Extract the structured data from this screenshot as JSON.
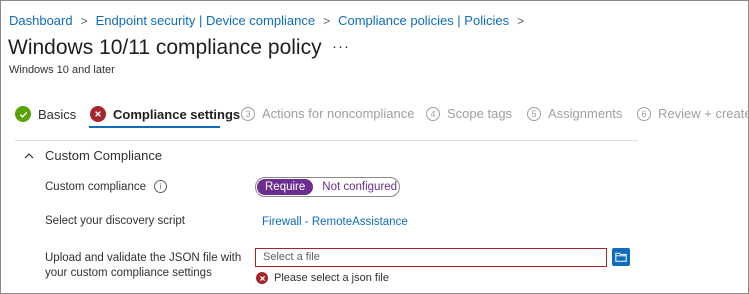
{
  "breadcrumb": {
    "items": [
      "Dashboard",
      "Endpoint security | Device compliance",
      "Compliance policies | Policies"
    ],
    "separator": ">"
  },
  "page": {
    "title": "Windows 10/11 compliance policy",
    "more": "···",
    "subtitle": "Windows 10 and later"
  },
  "wizard": {
    "steps": [
      {
        "number": "",
        "label": "Basics",
        "state": "completed",
        "icon": "check-icon"
      },
      {
        "number": "",
        "label": "Compliance settings",
        "state": "current-error",
        "icon": "error-icon"
      },
      {
        "number": "3",
        "label": "Actions for noncompliance",
        "state": "pending"
      },
      {
        "number": "4",
        "label": "Scope tags",
        "state": "pending"
      },
      {
        "number": "5",
        "label": "Assignments",
        "state": "pending"
      },
      {
        "number": "6",
        "label": "Review + create",
        "state": "pending"
      }
    ]
  },
  "section": {
    "title": "Custom Compliance",
    "expanded": true,
    "custom_compliance": {
      "label": "Custom compliance",
      "info_icon": "i",
      "options": [
        "Require",
        "Not configured"
      ],
      "selected": "Require"
    },
    "discovery_script": {
      "label": "Select your discovery script",
      "value": "Firewall - RemoteAssistance"
    },
    "json_upload": {
      "label_line1": "Upload and validate the JSON file with",
      "label_line2": "your custom compliance settings",
      "placeholder": "Select a file",
      "error": "Please select a json file"
    }
  },
  "colors": {
    "link": "#0f6cbd",
    "toggle_accent": "#6b2d8f",
    "error": "#a4262c",
    "success": "#57a300"
  }
}
